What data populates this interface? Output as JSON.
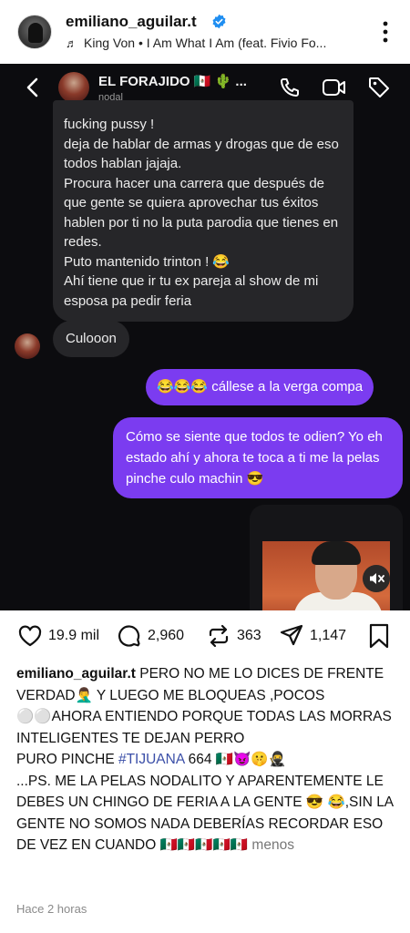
{
  "post": {
    "username": "emiliano_aguilar.t",
    "music": "King Von • I Am What I Am (feat. Fivio Fo...",
    "icons": [
      "avatar",
      "verified-icon",
      "music-note-icon",
      "more-options-icon"
    ]
  },
  "dm": {
    "chat_name": "EL FORAJIDO 🇲🇽 🌵 ...",
    "chat_subtitle": "nodal",
    "incoming_long": [
      "fucking pussy !",
      "deja de hablar de armas y drogas que de eso todos hablan jajaja.",
      "Procura hacer una carrera que después de que gente se quiera aprovechar tus éxitos hablen por ti no la puta parodia que tienes en redes.",
      "Puto mantenido trinton ! 😂",
      "Ahí tiene que ir tu ex pareja al show de mi esposa pa pedir feria"
    ],
    "incoming_short": "Culooon",
    "outgoing_1": "😂😂😂 cállese a la verga compa",
    "outgoing_2": "Cómo se siente que todos te odien? Yo eh estado ahí y ahora te toca a ti me la pelas pinche culo machin 😎",
    "colors": {
      "background": "#0c0c0f",
      "incoming_bubble": "#262629",
      "outgoing_bubble": "#7b3cf0"
    }
  },
  "actions": {
    "likes": "19.9 mil",
    "comments": "2,960",
    "reposts": "363",
    "shares": "1,147"
  },
  "caption": {
    "username": "emiliano_aguilar.t",
    "text_1": "PERO NO ME LO DICES DE FRENTE VERDAD🤦‍♂️ Y LUEGO ME BLOQUEAS ,POCOS ⚪⚪AHORA ENTIENDO PORQUE TODAS LAS MORRAS INTELIGENTES TE DEJAN PERRO",
    "text_2": "PURO PINCHE ",
    "hashtag": "#TIJUANA",
    "text_3": " 664 🇲🇽😈🤫🥷",
    "text_4": "...PS. ME LA PELAS NODALITO Y APARENTEMENTE LE DEBES UN CHINGO DE FERIA A LA GENTE 😎 😂,SIN LA GENTE NO SOMOS NADA DEBERÍAS RECORDAR ESO DE VEZ EN CUANDO 🇲🇽🇲🇽🇲🇽🇲🇽🇲🇽",
    "more": "menos"
  },
  "timestamp": "Hace 2 horas"
}
